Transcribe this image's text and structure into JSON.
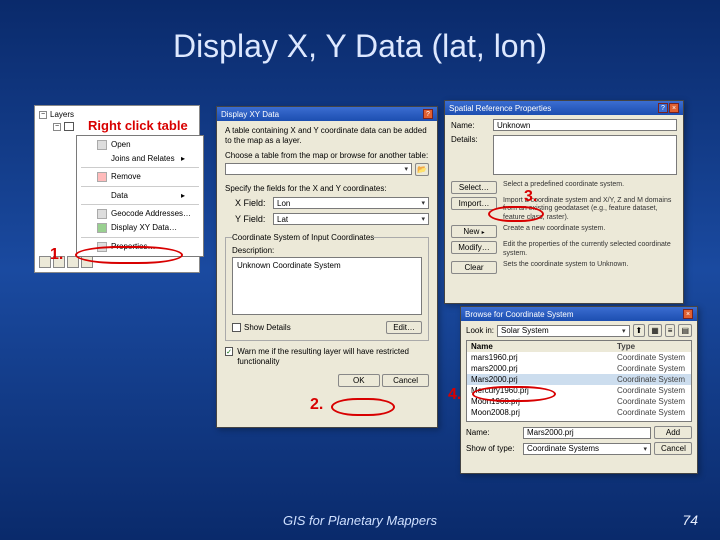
{
  "slide": {
    "title": "Display X, Y Data (lat, lon)",
    "footer": "GIS for Planetary Mappers",
    "page": "74",
    "right_click_label": "Right click table"
  },
  "steps": {
    "s1": "1.",
    "s2": "2.",
    "s3": "3.",
    "s4": "4."
  },
  "toc": {
    "root": "Layers"
  },
  "context_menu": {
    "open": "Open",
    "joins": "Joins and Relates",
    "remove": "Remove",
    "data": "Data",
    "geocode": "Geocode Addresses…",
    "display_xy": "Display XY Data…",
    "properties": "Properties…"
  },
  "xy_dialog": {
    "title": "Display XY Data",
    "intro": "A table containing X and Y coordinate data can be added to the map as a layer.",
    "choose_table": "Choose a table from the map or browse for another table:",
    "spec_fields": "Specify the fields for the X and Y coordinates:",
    "x_label": "X Field:",
    "y_label": "Y Field:",
    "x_value": "Lon",
    "y_value": "Lat",
    "cs_header": "Coordinate System of Input Coordinates",
    "desc_label": "Description:",
    "desc_text": "Unknown Coordinate System",
    "show_details": "Show Details",
    "edit": "Edit…",
    "warn": "Warn me if the resulting layer will have restricted functionality",
    "ok": "OK",
    "cancel": "Cancel"
  },
  "srp": {
    "title": "Spatial Reference Properties",
    "name_label": "Name:",
    "name_value": "Unknown",
    "details_label": "Details:",
    "select": "Select…",
    "select_desc": "Select a predefined coordinate system.",
    "import": "Import…",
    "import_desc": "Import a coordinate system and X/Y, Z and M domains from an existing geodataset (e.g., feature dataset, feature class, raster).",
    "new": "New",
    "new_desc": "Create a new coordinate system.",
    "modify": "Modify…",
    "modify_desc": "Edit the properties of the currently selected coordinate system.",
    "clear": "Clear",
    "clear_desc": "Sets the coordinate system to Unknown."
  },
  "browse": {
    "title": "Browse for Coordinate System",
    "lookin_label": "Look in:",
    "lookin_value": "Solar System",
    "rows": [
      {
        "name": "mars1960.prj",
        "type": "Coordinate System"
      },
      {
        "name": "mars2000.prj",
        "type": "Coordinate System"
      },
      {
        "name": "Mars2000.prj",
        "type": "Coordinate System"
      },
      {
        "name": "Mercury1960.prj",
        "type": "Coordinate System"
      },
      {
        "name": "Moon1960.prj",
        "type": "Coordinate System"
      },
      {
        "name": "Moon2008.prj",
        "type": "Coordinate System"
      }
    ],
    "name_label": "Name:",
    "name_value": "Mars2000.prj",
    "type_label": "Show of type:",
    "type_value": "Coordinate Systems",
    "add": "Add",
    "cancel": "Cancel"
  }
}
